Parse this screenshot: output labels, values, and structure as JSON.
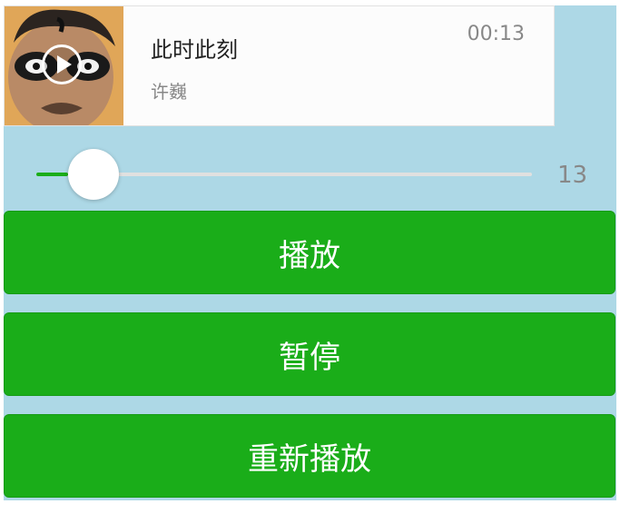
{
  "audio": {
    "name": "此时此刻",
    "author": "许巍",
    "current_time": "00:13",
    "cover_icon": "play-icon"
  },
  "slider": {
    "value": "13",
    "progress_fraction": 0.065,
    "active_color": "#1aad19",
    "track_color": "#e0e0e0"
  },
  "buttons": {
    "play_label": "播放",
    "pause_label": "暂停",
    "restart_label": "重新播放"
  },
  "colors": {
    "background": "#add8e6",
    "button": "#1aad19",
    "button_text": "#ffffff"
  }
}
